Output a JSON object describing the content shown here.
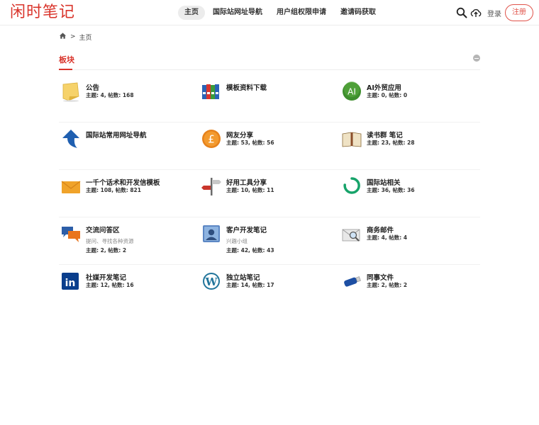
{
  "header": {
    "logo": "闲时笔记",
    "nav": [
      "主页",
      "国际站网址导航",
      "用户组权限申请",
      "邀请码获取"
    ],
    "icons": [
      "search-icon",
      "upload-cloud-icon"
    ],
    "login": "登录",
    "register": "注册",
    "accent_color": "#d9342b"
  },
  "breadcrumb": {
    "home_icon": "home-icon",
    "separator": ">",
    "current": "主页"
  },
  "section": {
    "title": "板块"
  },
  "forums": [
    {
      "name": "公告",
      "desc": "",
      "stats": "主题: 4, 帖数: 168",
      "icon": "sticky-note-icon"
    },
    {
      "name": "模板资料下载",
      "desc": "",
      "stats": "",
      "icon": "binders-icon"
    },
    {
      "name": "AI外贸应用",
      "desc": "",
      "stats": "主题: 0, 帖数: 0",
      "icon": "ai-badge-icon"
    },
    {
      "name": "国际站常用网址导航",
      "desc": "",
      "stats": "",
      "icon": "arrow-up-icon"
    },
    {
      "name": "网友分享",
      "desc": "",
      "stats": "主题: 53, 帖数: 56",
      "icon": "pound-coin-icon"
    },
    {
      "name": "读书群 笔记",
      "desc": "",
      "stats": "主题: 23, 帖数: 28",
      "icon": "open-book-icon"
    },
    {
      "name": "一千个话术和开发信模板",
      "desc": "",
      "stats": "主题: 108, 帖数: 821",
      "icon": "envelope-icon"
    },
    {
      "name": "好用工具分享",
      "desc": "",
      "stats": "主题: 10, 帖数: 11",
      "icon": "signpost-icon"
    },
    {
      "name": "国际站相关",
      "desc": "",
      "stats": "主题: 36, 帖数: 36",
      "icon": "loading-ring-icon"
    },
    {
      "name": "交流问答区",
      "desc": "提问、寻找各种资源",
      "stats": "主题: 2, 帖数: 2",
      "icon": "chat-bubbles-icon"
    },
    {
      "name": "客户开发笔记",
      "desc": "兴趣小组",
      "stats": "主题: 42, 帖数: 43",
      "icon": "contact-card-icon"
    },
    {
      "name": "商务邮件",
      "desc": "",
      "stats": "主题: 4, 帖数: 4",
      "icon": "mail-search-icon"
    },
    {
      "name": "社媒开发笔记",
      "desc": "",
      "stats": "主题: 12, 帖数: 16",
      "icon": "linkedin-icon"
    },
    {
      "name": "独立站笔记",
      "desc": "",
      "stats": "主题: 14, 帖数: 17",
      "icon": "wordpress-icon"
    },
    {
      "name": "同事文件",
      "desc": "",
      "stats": "主题: 2, 帖数: 2",
      "icon": "usb-drive-icon"
    }
  ]
}
